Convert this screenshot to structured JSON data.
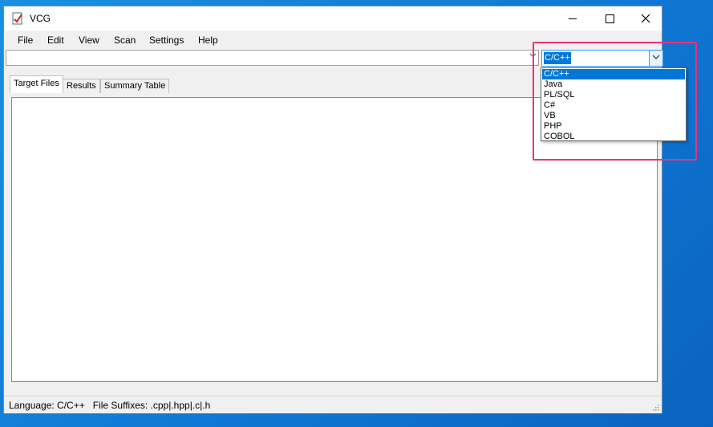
{
  "window": {
    "title": "VCG"
  },
  "menu": [
    "File",
    "Edit",
    "View",
    "Scan",
    "Settings",
    "Help"
  ],
  "path_combo": {
    "value": ""
  },
  "language_combo": {
    "selected": "C/C++"
  },
  "tabs": [
    "Target Files",
    "Results",
    "Summary Table"
  ],
  "dropdown_options": [
    "C/C++",
    "Java",
    "PL/SQL",
    "C#",
    "VB",
    "PHP",
    "COBOL"
  ],
  "status": {
    "text": "Language: C/C++   File Suffixes: .cpp|.hpp|.c|.h"
  },
  "colors": {
    "highlight": "#e8337d",
    "selection": "#0078d7",
    "desktop": "#0f78d4"
  }
}
